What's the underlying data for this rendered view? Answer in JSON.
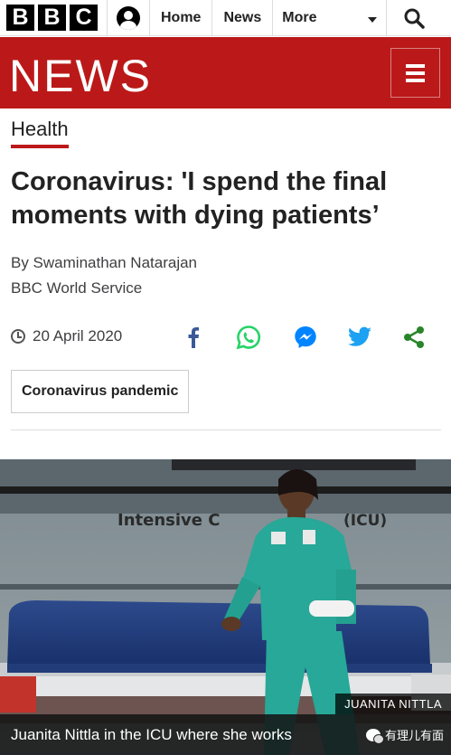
{
  "topbar": {
    "logo_letters": [
      "B",
      "B",
      "C"
    ],
    "account_icon": "account-icon",
    "nav": [
      "Home",
      "News",
      "More"
    ],
    "search_icon": "search-icon"
  },
  "header": {
    "title": "NEWS",
    "menu_icon": "hamburger-menu-icon",
    "brand_color": "#bb1919"
  },
  "article": {
    "section": "Health",
    "headline": "Coronavirus: 'I spend the final moments with dying patients’",
    "byline": "By Swaminathan Natarajan",
    "byorg": "BBC World Service",
    "date": "20 April 2020",
    "share": [
      {
        "icon": "facebook-icon",
        "color": "#3b5998"
      },
      {
        "icon": "whatsapp-icon",
        "color": "#25d366"
      },
      {
        "icon": "messenger-icon",
        "color": "#0084ff"
      },
      {
        "icon": "twitter-icon",
        "color": "#1da1f2"
      },
      {
        "icon": "share-icon",
        "color": "#29852b"
      }
    ],
    "topic": "Coronavirus pandemic"
  },
  "photo": {
    "wall_sign": "Intensive C",
    "wall_sign_end": "(ICU)",
    "credit": "JUANITA NITTLA",
    "caption": "Juanita Nittla in the ICU where she works"
  },
  "watermark": {
    "text": "有理儿有面"
  }
}
